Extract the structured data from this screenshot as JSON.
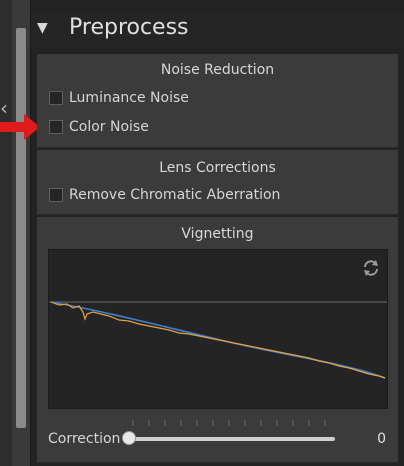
{
  "section": {
    "title": "Preprocess",
    "collapse_glyph": "▼"
  },
  "noise_reduction": {
    "title": "Noise Reduction",
    "items": [
      {
        "label": "Luminance Noise",
        "checked": false
      },
      {
        "label": "Color Noise",
        "checked": false
      }
    ]
  },
  "lens_corrections": {
    "title": "Lens Corrections",
    "items": [
      {
        "label": "Remove Chromatic Aberration",
        "checked": false
      }
    ]
  },
  "vignetting": {
    "title": "Vignetting",
    "correction_label": "Correction",
    "correction_value": "0",
    "refresh_icon": "refresh-icon"
  },
  "colors": {
    "pointer_arrow": "#e01b1b",
    "curve_blue": "#3f7fd6",
    "curve_orange": "#e5a13d"
  }
}
